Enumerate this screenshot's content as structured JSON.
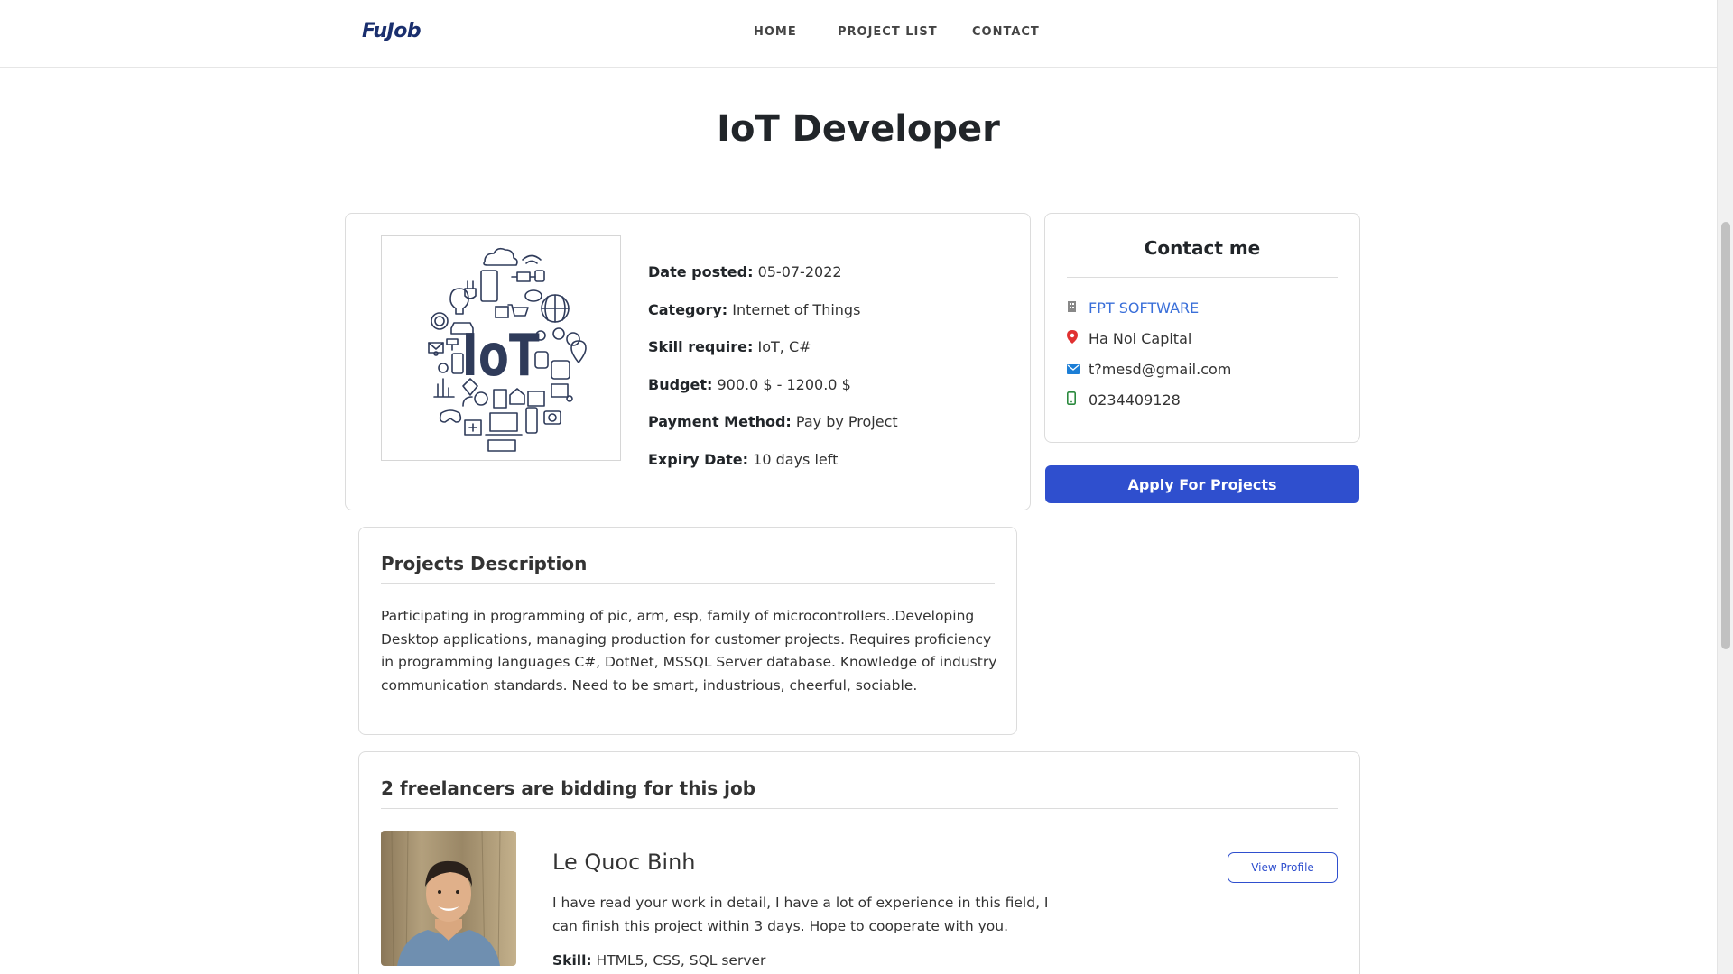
{
  "header": {
    "logo": "FuJob",
    "nav": [
      {
        "label": "HOME"
      },
      {
        "label": "PROJECT LIST"
      },
      {
        "label": "CONTACT"
      }
    ]
  },
  "project": {
    "title": "IoT Developer",
    "image_text": "IoT",
    "details": [
      {
        "label": "Date posted:",
        "value": "05-07-2022"
      },
      {
        "label": "Category:",
        "value": "Internet of Things"
      },
      {
        "label": "Skill require:",
        "value": "IoT, C#"
      },
      {
        "label": "Budget:",
        "value": "900.0 $ - 1200.0 $"
      },
      {
        "label": "Payment Method:",
        "value": "Pay by Project"
      },
      {
        "label": "Expiry Date:",
        "value": "10 days left"
      }
    ]
  },
  "contact": {
    "title": "Contact me",
    "company": "FPT SOFTWARE",
    "location": "Ha Noi Capital",
    "email": "t?mesd@gmail.com",
    "phone": "0234409128",
    "icons": {
      "company": "building-icon",
      "location": "map-pin-icon",
      "email": "envelope-icon",
      "phone": "phone-icon"
    }
  },
  "apply_button": "Apply For Projects",
  "description": {
    "title": "Projects Description",
    "text": "Participating in programming of pic, arm, esp, family of microcontrollers..Developing Desktop applications, managing production for customer projects. Requires proficiency in programming languages C#, DotNet, MSSQL Server database. Knowledge of industry communication standards. Need to be smart, industrious, cheerful, sociable."
  },
  "bids": {
    "title": "2 freelancers are bidding for this job",
    "items": [
      {
        "name": "Le Quoc Binh",
        "message": "I have read your work in detail, I have a lot of experience in this field, I can finish this project within 3 days. Hope to cooperate with you.",
        "skill_label": "Skill:",
        "skill_value": "HTML5, CSS, SQL server",
        "view_button": "View Profile"
      }
    ]
  },
  "colors": {
    "primary": "#2f4fce",
    "link": "#3a6fd9",
    "logo": "#1a2f6e",
    "logo_accent": "#f2a900",
    "pin": "#e03131",
    "mail": "#1c7ed6"
  }
}
